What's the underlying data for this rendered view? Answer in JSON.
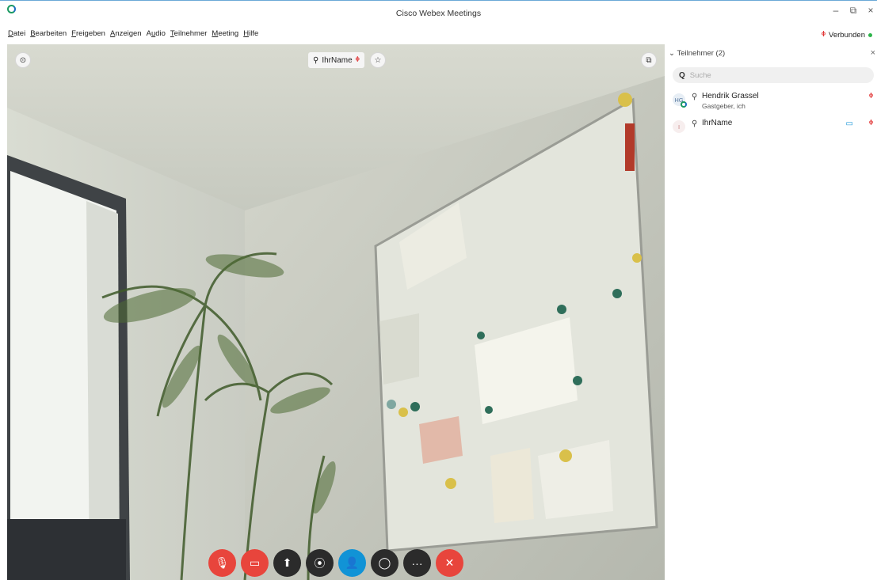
{
  "window": {
    "title": "Cisco Webex Meetings",
    "minimize": "–",
    "restore": "⧉",
    "close": "×"
  },
  "menu": [
    {
      "first": "D",
      "rest": "atei"
    },
    {
      "first": "B",
      "rest": "earbeiten"
    },
    {
      "first": "F",
      "rest": "reigeben"
    },
    {
      "first": "A",
      "rest": "nzeigen"
    },
    {
      "first": "A",
      "rest": "udio",
      "pre": "A",
      "under": "u",
      "post": "dio"
    },
    {
      "first": "T",
      "rest": "eilnehmer"
    },
    {
      "first": "M",
      "rest": "eeting"
    },
    {
      "first": "H",
      "rest": "ilfe"
    }
  ],
  "status": {
    "label": "Verbunden",
    "dot_color": "#2db44a"
  },
  "video": {
    "name_label": "IhrName"
  },
  "controls": [
    {
      "name": "mute",
      "glyph": "🎙",
      "color": "red"
    },
    {
      "name": "stop-video",
      "glyph": "▭",
      "color": "red"
    },
    {
      "name": "share",
      "glyph": "⬆",
      "color": "dark"
    },
    {
      "name": "record",
      "glyph": "⦿",
      "color": "dark"
    },
    {
      "name": "participants",
      "glyph": "👤",
      "color": "blue"
    },
    {
      "name": "chat",
      "glyph": "◯",
      "color": "dark"
    },
    {
      "name": "more",
      "glyph": "···",
      "color": "dark"
    },
    {
      "name": "end",
      "glyph": "✕",
      "color": "red"
    }
  ],
  "panel": {
    "header": "Teilnehmer (2)",
    "close": "×",
    "search_placeholder": "Suche",
    "participants": [
      {
        "initials": "HG",
        "name": "Hendrik Grassel",
        "role": "Gastgeber, ich"
      },
      {
        "initials": "I",
        "name": "IhrName",
        "role": ""
      }
    ]
  },
  "colors": {
    "accent": "#1193d6",
    "end_red": "#e8453c",
    "mute_red": "#e02a2a"
  }
}
